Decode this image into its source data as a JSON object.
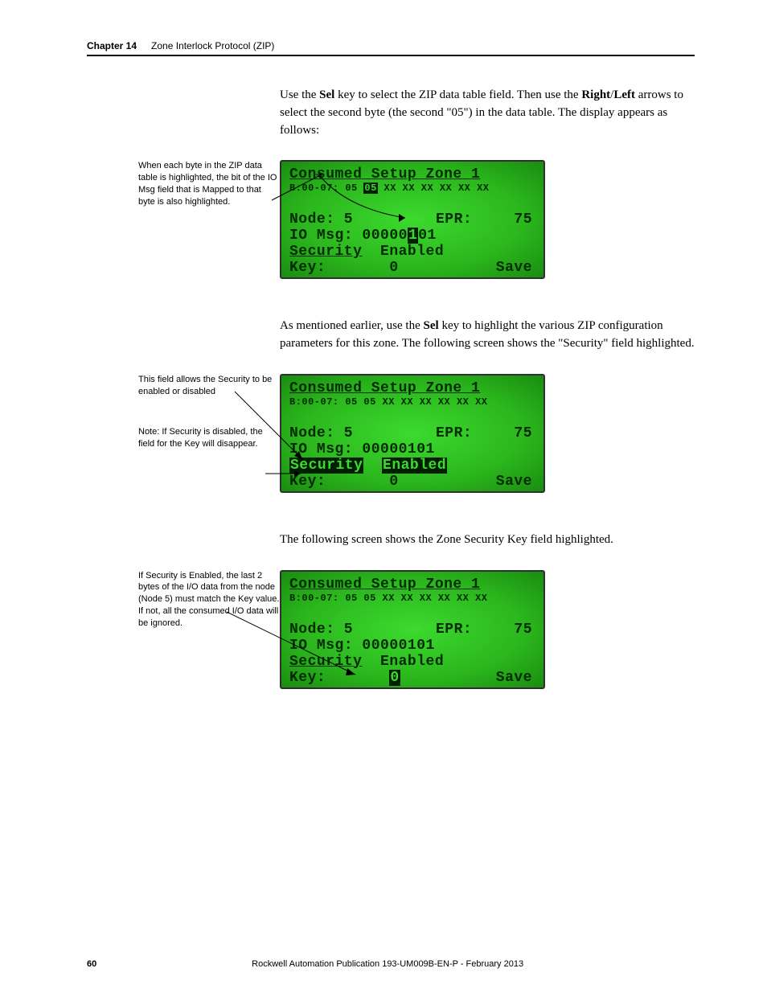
{
  "header": {
    "chapter_label": "Chapter 14",
    "chapter_title": "Zone Interlock Protocol (ZIP)"
  },
  "para1_pre": "Use the ",
  "para1_b1": "Sel",
  "para1_mid1": " key to select the ZIP data table field. Then use the ",
  "para1_b2": "Right",
  "para1_mid2": "/",
  "para1_b3": "Left",
  "para1_post": " arrows to select the second byte (the second \"05\") in the data table. The display appears as follows:",
  "fig1": {
    "callout1": "When each byte in the ZIP data table is highlighted, the bit of the IO Msg field that is Mapped to that byte is also highlighted.",
    "lcd": {
      "title": "Consumed Setup Zone 1",
      "row_label": "B:00-07:",
      "bytes": [
        "05",
        "05",
        "XX",
        "XX",
        "XX",
        "XX",
        "XX",
        "XX"
      ],
      "highlight_index": 1,
      "node": "Node: 5",
      "epr": "EPR:",
      "epr_val": "75",
      "iomsg_label": "IO Msg: ",
      "iomsg_val_pre": "00000",
      "iomsg_hl": "1",
      "iomsg_val_post": "01",
      "security": "Security",
      "sec_val": "Enabled",
      "key": "Key:",
      "key_val": "0",
      "save": "Save"
    }
  },
  "para2_pre": "As mentioned earlier, use the ",
  "para2_b1": "Sel",
  "para2_post": " key to highlight the various ZIP configuration parameters for this zone. The following screen shows the \"Security\" field highlighted.",
  "fig2": {
    "callout1": "This field allows the Security to be enabled or disabled",
    "callout2": "Note: If Security is disabled, the field for the Key will disappear.",
    "lcd": {
      "title": "Consumed Setup Zone 1",
      "row_label": "B:00-07:",
      "bytes": [
        "05",
        "05",
        "XX",
        "XX",
        "XX",
        "XX",
        "XX",
        "XX"
      ],
      "node": "Node: 5",
      "epr": "EPR:",
      "epr_val": "75",
      "iomsg": "IO Msg: 00000101",
      "security_hl": "Security",
      "sec_val_hl": "Enabled",
      "key": "Key:",
      "key_val": "0",
      "save": "Save"
    }
  },
  "para3": "The following screen shows the Zone Security Key field highlighted.",
  "fig3": {
    "callout1": "If Security is Enabled, the last 2 bytes of the I/O data from the node (Node 5) must match the Key value. If not, all the consumed I/O data will be ignored.",
    "lcd": {
      "title": "Consumed Setup Zone 1",
      "row_label": "B:00-07:",
      "bytes": [
        "05",
        "05",
        "XX",
        "XX",
        "XX",
        "XX",
        "XX",
        "XX"
      ],
      "node": "Node: 5",
      "epr": "EPR:",
      "epr_val": "75",
      "iomsg": "IO Msg: 00000101",
      "security": "Security",
      "sec_val": "Enabled",
      "key": "Key:",
      "key_val_hl": "0",
      "save": "Save"
    }
  },
  "footer": {
    "page": "60",
    "pub": "Rockwell Automation Publication 193-UM009B-EN-P - February 2013"
  }
}
